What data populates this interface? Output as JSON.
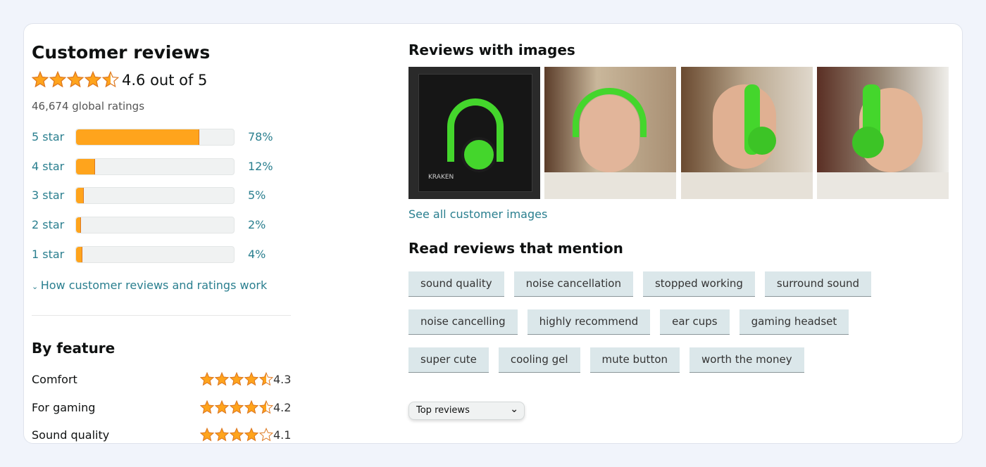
{
  "summary": {
    "title": "Customer reviews",
    "rating": 4.6,
    "rating_text": "4.6 out of 5",
    "global_ratings": "46,674 global ratings"
  },
  "histogram": [
    {
      "label": "5 star",
      "percent": 78,
      "percent_text": "78%"
    },
    {
      "label": "4 star",
      "percent": 12,
      "percent_text": "12%"
    },
    {
      "label": "3 star",
      "percent": 5,
      "percent_text": "5%"
    },
    {
      "label": "2 star",
      "percent": 2,
      "percent_text": "2%"
    },
    {
      "label": "1 star",
      "percent": 4,
      "percent_text": "4%"
    }
  ],
  "how_link": "How customer reviews and ratings work",
  "by_feature": {
    "title": "By feature",
    "items": [
      {
        "name": "Comfort",
        "rating": 4.3,
        "rating_text": "4.3"
      },
      {
        "name": "For gaming",
        "rating": 4.2,
        "rating_text": "4.2"
      },
      {
        "name": "Sound quality",
        "rating": 4.1,
        "rating_text": "4.1"
      }
    ]
  },
  "images": {
    "title": "Reviews with images",
    "box_text": "KRAKEN",
    "see_all": "See all customer images"
  },
  "mentions": {
    "title": "Read reviews that mention",
    "chips": [
      "sound quality",
      "noise cancellation",
      "stopped working",
      "surround sound",
      "noise cancelling",
      "highly recommend",
      "ear cups",
      "gaming headset",
      "super cute",
      "cooling gel",
      "mute button",
      "worth the money"
    ]
  },
  "sort": {
    "selected": "Top reviews"
  },
  "colors": {
    "star": "#ffa41c",
    "link": "#2a7f8f",
    "chip": "#dbe7ea",
    "headset": "#44d62c"
  }
}
